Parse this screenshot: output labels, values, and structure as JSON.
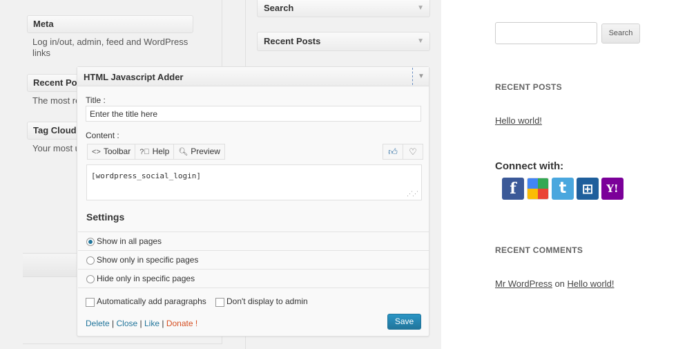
{
  "left_widgets": {
    "meta": {
      "title": "Meta",
      "desc": "Log in/out, admin, feed and WordPress links"
    },
    "recent_posts": {
      "title": "Recent Posts",
      "desc": "The most recent posts on your site"
    },
    "tag_cloud": {
      "title": "Tag Cloud",
      "desc": "Your most used tags in cloud format"
    }
  },
  "sidebar": {
    "items": [
      {
        "label": "Search"
      },
      {
        "label": "Recent Posts"
      }
    ]
  },
  "popup": {
    "title": "HTML Javascript Adder",
    "title_label": "Title :",
    "title_value": "Enter the title here",
    "content_label": "Content :",
    "toolbar": {
      "toolbar": "Toolbar",
      "help": "Help",
      "preview": "Preview"
    },
    "content_value": "[wordpress_social_login]",
    "settings_heading": "Settings",
    "options": [
      {
        "label": "Show in all pages",
        "selected": true
      },
      {
        "label": "Show only in specific pages",
        "selected": false
      },
      {
        "label": "Hide only in specific pages",
        "selected": false
      }
    ],
    "checkboxes": {
      "auto_paragraphs": "Automatically add paragraphs",
      "no_admin": "Don't display to admin"
    },
    "links": {
      "delete": "Delete",
      "close": "Close",
      "like": "Like",
      "donate": "Donate !",
      "sep": "|"
    },
    "save_label": "Save"
  },
  "site": {
    "search_button": "Search",
    "recent_posts_heading": "RECENT POSTS",
    "recent_post": "Hello world!",
    "connect_heading": "Connect with:",
    "social": [
      {
        "name": "facebook-icon",
        "glyph": "f",
        "color": "#3b5998"
      },
      {
        "name": "google-icon",
        "glyph": "g",
        "color": "#ffffff"
      },
      {
        "name": "twitter-icon",
        "glyph": "t",
        "color": "#4aa7de"
      },
      {
        "name": "windows-live-icon",
        "glyph": "⊞",
        "color": "#1f5f9c"
      },
      {
        "name": "yahoo-icon",
        "glyph": "Y!",
        "color": "#7b0099"
      }
    ],
    "recent_comments_heading": "RECENT COMMENTS",
    "comment": {
      "author": "Mr WordPress",
      "on": "on",
      "post": "Hello world!"
    }
  },
  "colors": {
    "accent": "#21759b",
    "donate": "#d54e21"
  }
}
